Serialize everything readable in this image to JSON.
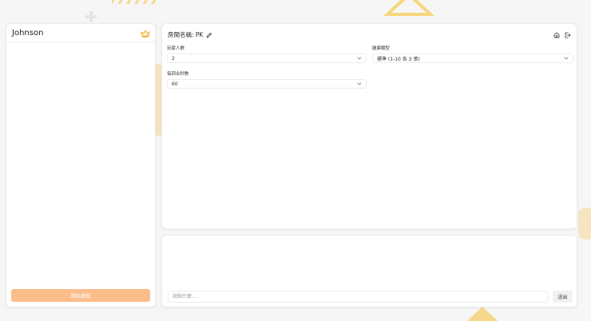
{
  "players": {
    "list": [
      {
        "name": "Johnson",
        "is_host": true
      }
    ],
    "start_label": "開始遊戲"
  },
  "room": {
    "title": "房間名稱: PK"
  },
  "settings": {
    "player_count": {
      "label": "玩家人數",
      "value": "2"
    },
    "question_type": {
      "label": "題庫類型",
      "value": "標準 (1-10 各 3 張)"
    },
    "round_seconds": {
      "label": "每回合秒數",
      "value": "60"
    }
  },
  "chat": {
    "placeholder": "說點什麼...",
    "send_label": "送出"
  },
  "colors": {
    "accent": "#fbbd8a",
    "crown": "#f2b53a"
  }
}
